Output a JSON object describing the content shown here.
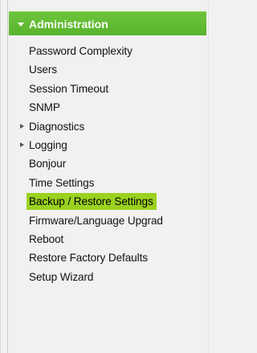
{
  "section": {
    "title": "Administration",
    "expanded": true,
    "header_color": "#5fbb31"
  },
  "menu": {
    "items": [
      {
        "label": "Password Complexity",
        "type": "link"
      },
      {
        "label": "Users",
        "type": "link"
      },
      {
        "label": "Session Timeout",
        "type": "link"
      },
      {
        "label": "SNMP",
        "type": "link"
      },
      {
        "label": "Diagnostics",
        "type": "group",
        "expanded": false
      },
      {
        "label": "Logging",
        "type": "group",
        "expanded": false
      },
      {
        "label": "Bonjour",
        "type": "link"
      },
      {
        "label": "Time Settings",
        "type": "link"
      },
      {
        "label": "Backup / Restore Settings",
        "type": "link",
        "selected": true
      },
      {
        "label": "Firmware/Language Upgrad",
        "type": "link"
      },
      {
        "label": "Reboot",
        "type": "link"
      },
      {
        "label": "Restore Factory Defaults",
        "type": "link"
      },
      {
        "label": "Setup Wizard",
        "type": "link"
      }
    ],
    "selected_color": "#9bd21f"
  }
}
